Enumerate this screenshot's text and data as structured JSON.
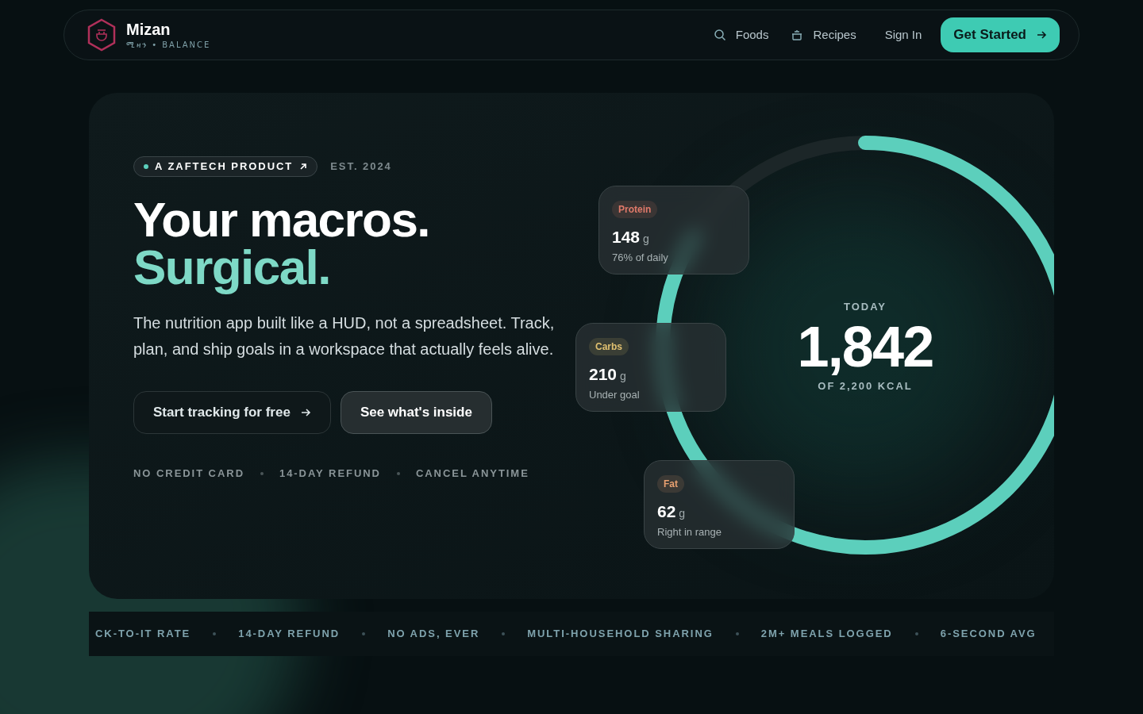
{
  "brand": {
    "name": "Mizan",
    "tagline": "ሚዛን • BALANCE"
  },
  "nav": [
    {
      "label": "Foods",
      "kind": "search"
    },
    {
      "label": "Recipes",
      "kind": "pot"
    }
  ],
  "sign_in": "Sign In",
  "cta": "Get Started",
  "hero": {
    "badge": "A ZAFTECH PRODUCT",
    "est": "EST. 2024",
    "title_1": "Your macros.",
    "title_2": "Surgical.",
    "body": "The nutrition app built like a HUD, not a spreadsheet. Track, plan, and ship goals in a workspace that actually feels alive.",
    "buttons": [
      "Start tracking for free",
      "See what's inside"
    ],
    "perks": [
      "NO CREDIT CARD",
      "14-DAY REFUND",
      "CANCEL ANYTIME"
    ]
  },
  "ring": {
    "label": "TODAY",
    "value": "1,842",
    "goal": "OF 2,200 KCAL",
    "level": 0.84
  },
  "macros": [
    {
      "name": "Protein",
      "value": "148",
      "unit": "g",
      "note": "76% of daily",
      "color": "#e07a6a"
    },
    {
      "name": "Carbs",
      "value": "210",
      "unit": "g",
      "note": "Under goal",
      "color": "#e0c070"
    },
    {
      "name": "Fat",
      "value": "62",
      "unit": "g",
      "note": "Right in range",
      "color": "#e8a070"
    }
  ],
  "ticker": [
    "CK-TO-IT RATE",
    "14-DAY REFUND",
    "NO ADS, EVER",
    "MULTI-HOUSEHOLD SHARING",
    "2M+ MEALS LOGGED",
    "6-SECOND AVG"
  ]
}
